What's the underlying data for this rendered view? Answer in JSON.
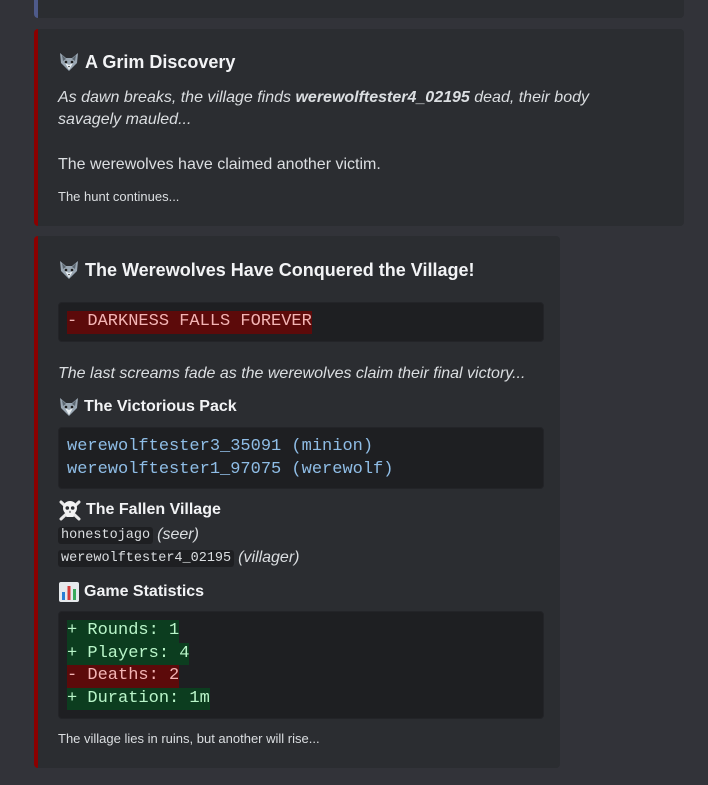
{
  "embed1": {
    "title": "A Grim Discovery",
    "desc_prefix": "As dawn breaks, the village finds ",
    "victim": "werewolftester4_02195",
    "desc_suffix": " dead, their body savagely mauled...",
    "line2": "The werewolves have claimed another victim.",
    "footer": "The hunt continues..."
  },
  "embed2": {
    "title": "The Werewolves Have Conquered the Village!",
    "banner": "- DARKNESS FALLS FOREVER",
    "italic": "The last screams fade as the werewolves claim their final victory...",
    "pack_title": "The Victorious Pack",
    "pack": [
      "werewolftester3_35091 (minion)",
      "werewolftester1_97075 (werewolf)"
    ],
    "fallen_title": "The Fallen Village",
    "fallen": [
      {
        "name": "honestojago",
        "role": "(seer)"
      },
      {
        "name": "werewolftester4_02195",
        "role": "(villager)"
      }
    ],
    "stats_title": "Game Statistics",
    "stats": [
      {
        "text": "+ Rounds: 1",
        "kind": "plus"
      },
      {
        "text": "+ Players: 4",
        "kind": "plus"
      },
      {
        "text": "- Deaths: 2",
        "kind": "minus"
      },
      {
        "text": "+ Duration: 1m",
        "kind": "plus"
      }
    ],
    "footer": "The village lies in ruins, but another will rise..."
  },
  "colors": {
    "accent": "#8b0000",
    "background": "#323339",
    "embed_bg": "#2b2d31",
    "code_bg": "#1e1f22"
  },
  "icons": [
    "wolf-icon",
    "skull-crossbones-icon",
    "bar-chart-icon"
  ]
}
